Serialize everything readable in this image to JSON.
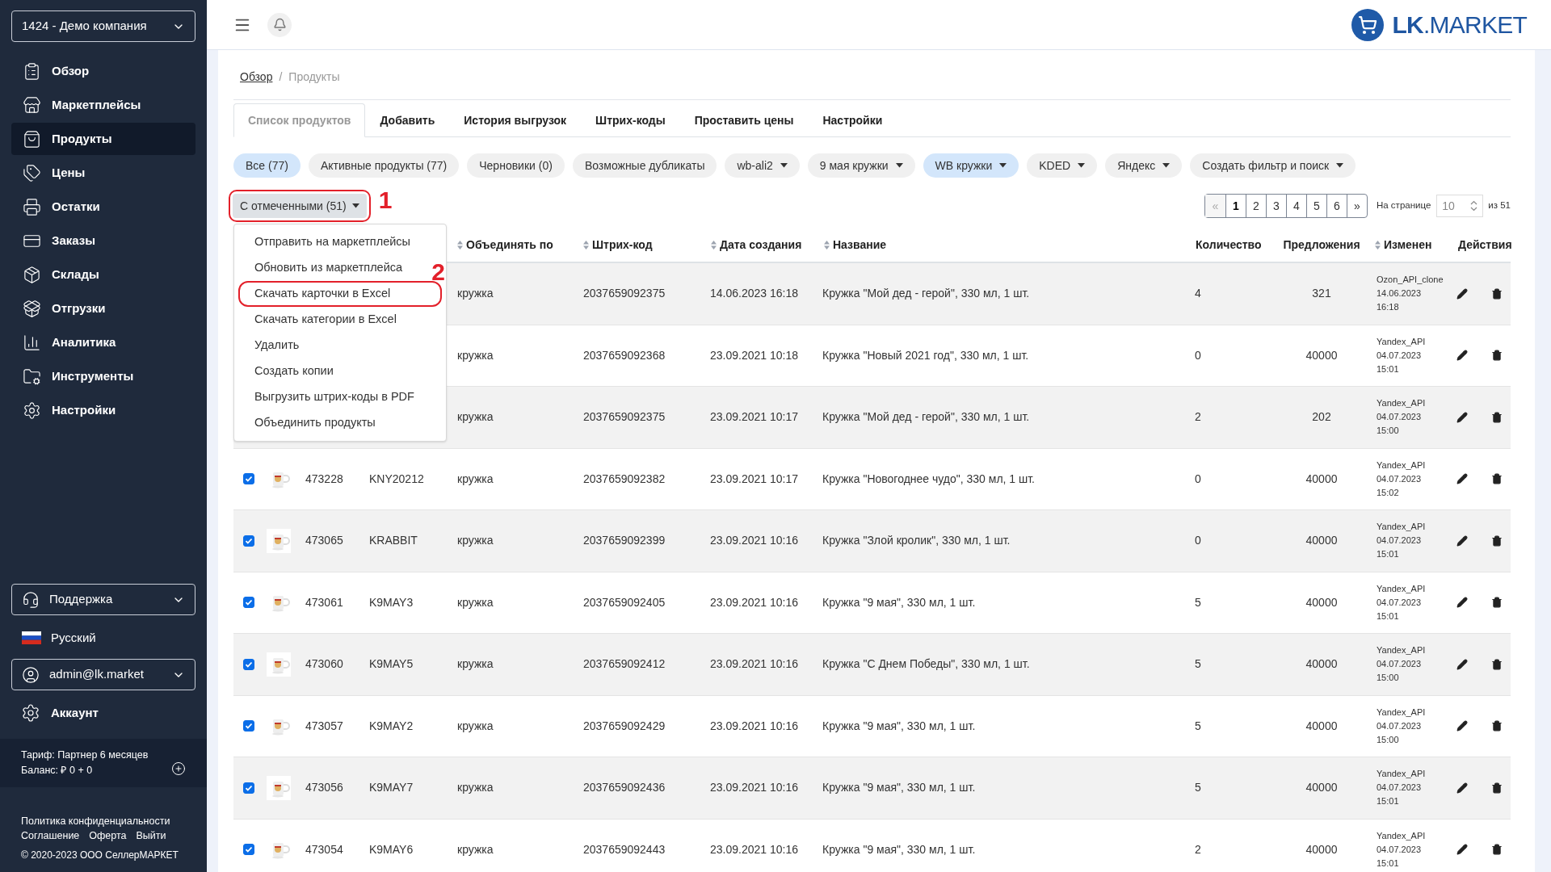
{
  "sidebar": {
    "company_select": "1424 - Демо компания",
    "items": [
      {
        "label": "Обзор",
        "selected": false
      },
      {
        "label": "Маркетплейсы",
        "selected": false
      },
      {
        "label": "Продукты",
        "selected": true
      },
      {
        "label": "Цены",
        "selected": false
      },
      {
        "label": "Остатки",
        "selected": false
      },
      {
        "label": "Заказы",
        "selected": false
      },
      {
        "label": "Склады",
        "selected": false
      },
      {
        "label": "Отгрузки",
        "selected": false
      },
      {
        "label": "Аналитика",
        "selected": false
      },
      {
        "label": "Инструменты",
        "selected": false
      },
      {
        "label": "Настройки",
        "selected": false
      }
    ],
    "support_select": "Поддержка",
    "language": "Русский",
    "user_select": "admin@lk.market",
    "account": "Аккаунт",
    "tariff": "Тариф: Партнер 6 месяцев",
    "balance": "Баланс: ₽ 0 + 0",
    "footer_links": [
      "Политика конфиденциальности",
      "Соглашение",
      "Оферта",
      "Выйти"
    ],
    "copyright": "© 2020-2023 ООО СеллерМАРКЕТ"
  },
  "header": {
    "logo": "**LK**.MARKET"
  },
  "breadcrumb": [
    {
      "label": "Обзор",
      "link": true
    },
    {
      "label": "Продукты",
      "link": false
    }
  ],
  "breadcrumb_separator": "/",
  "tabs": [
    {
      "label": "Список продуктов",
      "selected": true
    },
    {
      "label": "Добавить",
      "selected": false
    },
    {
      "label": "История выгрузок",
      "selected": false
    },
    {
      "label": "Штрих-коды",
      "selected": false
    },
    {
      "label": "Проставить цены",
      "selected": false
    },
    {
      "label": "Настройки",
      "selected": false
    }
  ],
  "filters": [
    {
      "label": "Все (77)",
      "selected": true,
      "dropdown": false
    },
    {
      "label": "Активные продукты (77)",
      "selected": false,
      "dropdown": false
    },
    {
      "label": "Черновики (0)",
      "selected": false,
      "dropdown": false
    },
    {
      "label": "Возможные дубликаты",
      "selected": false,
      "dropdown": false
    },
    {
      "label": "wb-ali2",
      "selected": false,
      "dropdown": true
    },
    {
      "label": "9 мая кружки",
      "selected": false,
      "dropdown": true
    },
    {
      "label": "WB кружки",
      "selected": true,
      "dropdown": true
    },
    {
      "label": "KDED",
      "selected": false,
      "dropdown": true
    },
    {
      "label": "Яндекс",
      "selected": false,
      "dropdown": true
    },
    {
      "label": "Создать фильтр и поиск",
      "selected": false,
      "dropdown": true
    }
  ],
  "bulk_button": {
    "label": "С отмеченными (51)",
    "highlighted": true,
    "callout": "1"
  },
  "bulk_menu": {
    "expanded": true,
    "items": [
      {
        "label": "Отправить на маркетплейсы",
        "highlighted": false
      },
      {
        "label": "Обновить из маркетплейса",
        "highlighted": false
      },
      {
        "label": "Скачать карточки в Excel",
        "highlighted": true,
        "callout": "2"
      },
      {
        "label": "Скачать категории в Excel",
        "highlighted": false
      },
      {
        "label": "Удалить",
        "highlighted": false
      },
      {
        "label": "Создать копии",
        "highlighted": false
      },
      {
        "label": "Выгрузить штрих-коды в PDF",
        "highlighted": false
      },
      {
        "label": "Объединить продукты",
        "highlighted": false
      }
    ]
  },
  "pagination": {
    "prev": "«",
    "pages": [
      {
        "label": "1",
        "selected": true
      },
      {
        "label": "2",
        "selected": false
      },
      {
        "label": "3",
        "selected": false
      },
      {
        "label": "4",
        "selected": false
      },
      {
        "label": "5",
        "selected": false
      },
      {
        "label": "6",
        "selected": false
      }
    ],
    "next": "»",
    "per_page_label": "На странице",
    "per_page": "10",
    "total": "из 51"
  },
  "table": {
    "columns": [
      {
        "label": "Объединять по",
        "sortable": true
      },
      {
        "label": "Штрих-код",
        "sortable": true
      },
      {
        "label": "Дата создания",
        "sortable": true
      },
      {
        "label": "Название",
        "sortable": true
      },
      {
        "label": "Количество",
        "sortable": false
      },
      {
        "label": "Предложения",
        "sortable": false
      },
      {
        "label": "Изменен",
        "sortable": true
      },
      {
        "label": "Действия",
        "sortable": false
      }
    ],
    "rows": [
      {
        "merge_by": "кружка",
        "barcode": "2037659092375",
        "created": "14.06.2023 16:18",
        "name": "Кружка \"Мой дед - герой\", 330 мл, 1 шт.",
        "quantity": "4",
        "offers": "321",
        "modified": [
          "Ozon_API_clone",
          "14.06.2023",
          "16:18"
        ]
      },
      {
        "merge_by": "кружка",
        "barcode": "2037659092368",
        "created": "23.09.2021 10:18",
        "name": "Кружка \"Новый 2021 год\", 330 мл, 1 шт.",
        "quantity": "0",
        "offers": "40000",
        "modified": [
          "Yandex_API",
          "04.07.2023",
          "15:01"
        ]
      },
      {
        "merge_by": "кружка",
        "barcode": "2037659092375",
        "created": "23.09.2021 10:17",
        "name": "Кружка \"Мой дед - герой\", 330 мл, 1 шт.",
        "quantity": "2",
        "offers": "202",
        "modified": [
          "Yandex_API",
          "04.07.2023",
          "15:00"
        ]
      },
      {
        "checked": true,
        "thumbnail": {
          "kind": "picture"
        },
        "id": "473228",
        "sku": "KNY20212",
        "merge_by": "кружка",
        "barcode": "2037659092382",
        "created": "23.09.2021 10:17",
        "name": "Кружка \"Новогоднее чудо\", 330 мл, 1 шт.",
        "quantity": "0",
        "offers": "40000",
        "modified": [
          "Yandex_API",
          "04.07.2023",
          "15:02"
        ]
      },
      {
        "checked": true,
        "thumbnail": {
          "kind": "picture"
        },
        "id": "473065",
        "sku": "KRABBIT",
        "merge_by": "кружка",
        "barcode": "2037659092399",
        "created": "23.09.2021 10:16",
        "name": "Кружка \"Злой кролик\", 330 мл, 1 шт.",
        "quantity": "0",
        "offers": "40000",
        "modified": [
          "Yandex_API",
          "04.07.2023",
          "15:01"
        ]
      },
      {
        "checked": true,
        "thumbnail": {
          "kind": "picture"
        },
        "id": "473061",
        "sku": "K9MAY3",
        "merge_by": "кружка",
        "barcode": "2037659092405",
        "created": "23.09.2021 10:16",
        "name": "Кружка \"9 мая\", 330 мл, 1 шт.",
        "quantity": "5",
        "offers": "40000",
        "modified": [
          "Yandex_API",
          "04.07.2023",
          "15:01"
        ]
      },
      {
        "checked": true,
        "thumbnail": {
          "kind": "picture"
        },
        "id": "473060",
        "sku": "K9MAY5",
        "merge_by": "кружка",
        "barcode": "2037659092412",
        "created": "23.09.2021 10:16",
        "name": "Кружка \"С Днем Победы\", 330 мл, 1 шт.",
        "quantity": "5",
        "offers": "40000",
        "modified": [
          "Yandex_API",
          "04.07.2023",
          "15:00"
        ]
      },
      {
        "checked": true,
        "thumbnail": {
          "kind": "picture"
        },
        "id": "473057",
        "sku": "K9MAY2",
        "merge_by": "кружка",
        "barcode": "2037659092429",
        "created": "23.09.2021 10:16",
        "name": "Кружка \"9 мая\", 330 мл, 1 шт.",
        "quantity": "5",
        "offers": "40000",
        "modified": [
          "Yandex_API",
          "04.07.2023",
          "15:00"
        ]
      },
      {
        "checked": true,
        "thumbnail": {
          "kind": "picture"
        },
        "id": "473056",
        "sku": "K9MAY7",
        "merge_by": "кружка",
        "barcode": "2037659092436",
        "created": "23.09.2021 10:16",
        "name": "Кружка \"9 мая\", 330 мл, 1 шт.",
        "quantity": "5",
        "offers": "40000",
        "modified": [
          "Yandex_API",
          "04.07.2023",
          "15:01"
        ]
      },
      {
        "checked": true,
        "thumbnail": {
          "kind": "picture"
        },
        "id": "473054",
        "sku": "K9MAY6",
        "merge_by": "кружка",
        "barcode": "2037659092443",
        "created": "23.09.2021 10:16",
        "name": "Кружка \"9 мая\", 330 мл, 1 шт.",
        "quantity": "2",
        "offers": "40000",
        "modified": [
          "Yandex_API",
          "04.07.2023",
          "15:01"
        ]
      }
    ]
  }
}
